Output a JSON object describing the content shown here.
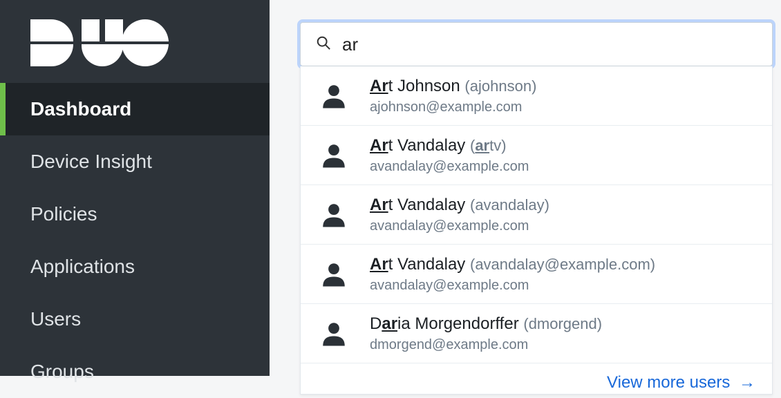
{
  "brand": "DUO",
  "colors": {
    "accent": "#6fbf4a",
    "link": "#1868d9"
  },
  "sidebar": {
    "items": [
      {
        "label": "Dashboard",
        "active": true
      },
      {
        "label": "Device Insight",
        "active": false
      },
      {
        "label": "Policies",
        "active": false
      },
      {
        "label": "Applications",
        "active": false
      },
      {
        "label": "Users",
        "active": false
      },
      {
        "label": "Groups",
        "active": false
      }
    ]
  },
  "search": {
    "query": "ar",
    "placeholder": "",
    "view_more_label": "View more users",
    "arrow_glyph": "→",
    "results": [
      {
        "name_pre": "",
        "name_hl": "Ar",
        "name_post": "t Johnson",
        "alias_pre": "",
        "alias_hl": "",
        "alias_post": "ajohnson",
        "email": "ajohnson@example.com"
      },
      {
        "name_pre": "",
        "name_hl": "Ar",
        "name_post": "t Vandalay",
        "alias_pre": "",
        "alias_hl": "ar",
        "alias_post": "tv",
        "email": "avandalay@example.com"
      },
      {
        "name_pre": "",
        "name_hl": "Ar",
        "name_post": "t Vandalay",
        "alias_pre": "",
        "alias_hl": "",
        "alias_post": "avandalay",
        "email": "avandalay@example.com"
      },
      {
        "name_pre": "",
        "name_hl": "Ar",
        "name_post": "t Vandalay",
        "alias_pre": "",
        "alias_hl": "",
        "alias_post": "avandalay@example.com",
        "email": "avandalay@example.com"
      },
      {
        "name_pre": "D",
        "name_hl": "ar",
        "name_post": "ia Morgendorffer",
        "alias_pre": "",
        "alias_hl": "",
        "alias_post": "dmorgend",
        "email": "dmorgend@example.com"
      }
    ]
  }
}
